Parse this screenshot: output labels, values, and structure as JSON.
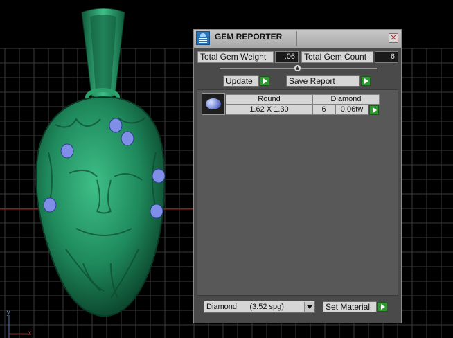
{
  "viewport": {
    "axis_y_label": "y",
    "axis_x_label": "x",
    "colors": {
      "background": "#000000",
      "grid": "#3a3a3a",
      "model": "#1f8a5c",
      "gems": "#7f8fe8"
    }
  },
  "panel": {
    "title": "GEM REPORTER",
    "close_icon": "close-icon",
    "total_gem_weight_label": "Total Gem Weight",
    "total_gem_weight_value": ".06",
    "total_gem_count_label": "Total Gem Count",
    "total_gem_count_value": "6",
    "update_label": "Update",
    "save_report_label": "Save Report",
    "gems": [
      {
        "shape": "Round",
        "material": "Diamond",
        "size": "1.62 X 1.30",
        "count": "6",
        "weight": "0.06tw"
      }
    ],
    "material_select_value": "Diamond      (3.52 spg)",
    "set_material_label": "Set Material",
    "colors": {
      "panel_bg": "#4a4a4a",
      "button_go": "#2f9a2f",
      "close_x": "#b03030"
    }
  }
}
